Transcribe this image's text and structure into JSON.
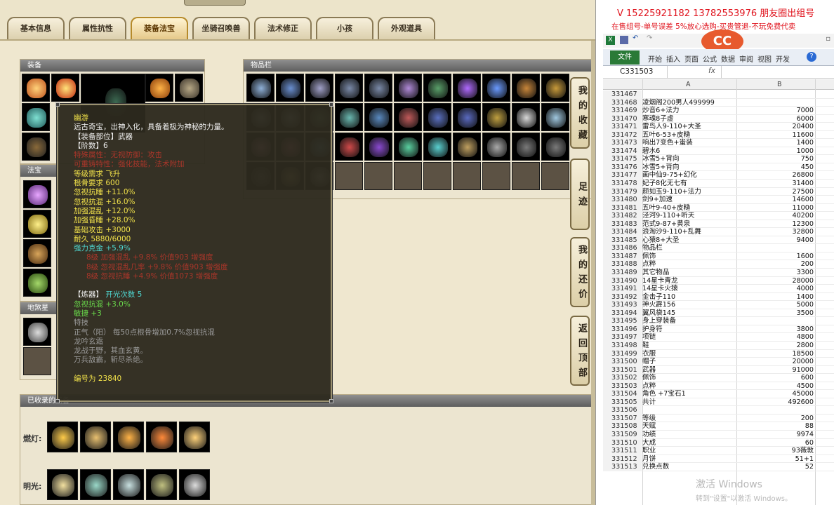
{
  "tabs": [
    {
      "label": "基本信息"
    },
    {
      "label": "属性抗性"
    },
    {
      "label": "装备法宝"
    },
    {
      "label": "坐骑召唤兽"
    },
    {
      "label": "法术修正"
    },
    {
      "label": "小孩"
    },
    {
      "label": "外观道具"
    }
  ],
  "active_tab": "装备法宝",
  "panels": {
    "equipment": "装备",
    "treasure": "法宝",
    "ground_soul": "地煞星",
    "inventory": "物品栏",
    "collected": "已收录的装备"
  },
  "collected": {
    "row1_label": "燃灯:",
    "row2_label": "明光:"
  },
  "side_buttons": [
    "我的收藏",
    "足迹",
    "我的还价",
    "返回顶部"
  ],
  "tooltip": {
    "name": "幽游",
    "desc": "远古奇宝，出神入化，具备着极为神秘的力量。",
    "part": "【装备部位】武器",
    "grade": "【阶数】6",
    "red1": "特殊属性：无视防御：攻击",
    "red2": "可重铸特性：强化技能，法术附加",
    "level_req": "等级需求 飞升",
    "bone_req": "根骨要求 600",
    "stats": [
      "忽视抗睡 +11.0%",
      "忽视抗混 +16.0%",
      "加强混乱 +12.0%",
      "加强昏睡 +28.0%",
      "基础攻击 +3000",
      "耐久 5880/6000"
    ],
    "strong": "强力克金 +5.9%",
    "gems": [
      "8级 加强混乱 +9.8% 价值903 增强度",
      "8级 忽视混乱几率 +9.8% 价值903 增强度",
      "8级 忽视抗睡 +4.9% 价值1073 增强度"
    ],
    "refine_label": "【炼器】",
    "refine_open": "开光次数 5",
    "refine1": "忽视抗混 +3.0%",
    "refine2": "敏捷 +3",
    "special_title": "特技",
    "special1": "正气（阳） 每50点根骨增加0.7%忽视抗混",
    "special2": "龙吟玄霜",
    "special3": "龙战于野，其血玄黄。",
    "special4": "万兵敌霸，斩尽杀绝。",
    "serial": "编号为 23840"
  },
  "excel": {
    "ad_line1": "V 15225921182   13782553976 朋友圈出组号",
    "ad_line2": "在售组号-单号误差 5%放心选购-买贵管退-不玩免费代卖",
    "ribbon": [
      "文件",
      "开始",
      "插入",
      "页面",
      "公式",
      "数据",
      "审阅",
      "视图",
      "开发"
    ],
    "namebox": "C331503",
    "fx": "fx",
    "col_a": "A",
    "col_b": "B",
    "rows": [
      {
        "n": "331467",
        "a": "",
        "b": ""
      },
      {
        "n": "331468",
        "a": "凌烟阁200男人499999",
        "b": ""
      },
      {
        "n": "331469",
        "a": "炒音6+法力",
        "b": "7000"
      },
      {
        "n": "331470",
        "a": "寒魂8子虚",
        "b": "6000"
      },
      {
        "n": "331471",
        "a": "雷鸟人9-110+大圣",
        "b": "20400"
      },
      {
        "n": "331472",
        "a": "五叶6-53+皮糙",
        "b": "11600"
      },
      {
        "n": "331473",
        "a": "响出7变色+蚩装",
        "b": "1400"
      },
      {
        "n": "331474",
        "a": "碧水6",
        "b": "1000"
      },
      {
        "n": "331475",
        "a": "冰雪5+背向",
        "b": "750"
      },
      {
        "n": "331476",
        "a": "冰雪5+背向",
        "b": "450"
      },
      {
        "n": "331477",
        "a": "画中仙9-75+幻化",
        "b": "26800"
      },
      {
        "n": "331478",
        "a": "妃子8化无七有",
        "b": "31400"
      },
      {
        "n": "331479",
        "a": "颜如玉9-110+法力",
        "b": "27500"
      },
      {
        "n": "331480",
        "a": "剑9+加速",
        "b": "14600"
      },
      {
        "n": "331481",
        "a": "五叶9-40+皮糙",
        "b": "11000"
      },
      {
        "n": "331482",
        "a": "泾河9-110+听天",
        "b": "40200"
      },
      {
        "n": "331483",
        "a": "范式9-87+黄泉",
        "b": "12300"
      },
      {
        "n": "331484",
        "a": "浪淘沙9-110+乱舞",
        "b": "32800"
      },
      {
        "n": "331485",
        "a": "心猿8+大圣",
        "b": "9400"
      },
      {
        "n": "331486",
        "a": "物品栏",
        "b": ""
      },
      {
        "n": "331487",
        "a": "佩饰",
        "b": "1600"
      },
      {
        "n": "331488",
        "a": "点粹",
        "b": "200"
      },
      {
        "n": "331489",
        "a": "其它物品",
        "b": "3300"
      },
      {
        "n": "331490",
        "a": "14星卡青龙",
        "b": "28000"
      },
      {
        "n": "331491",
        "a": "14星卡火猿",
        "b": "4000"
      },
      {
        "n": "331492",
        "a": "金击子110",
        "b": "1400"
      },
      {
        "n": "331493",
        "a": "神火霹156",
        "b": "5000"
      },
      {
        "n": "331494",
        "a": "翼风袋145",
        "b": "3500"
      },
      {
        "n": "331495",
        "a": "身上穿装备",
        "b": ""
      },
      {
        "n": "331496",
        "a": "护身符",
        "b": "3800"
      },
      {
        "n": "331497",
        "a": "项链",
        "b": "4800"
      },
      {
        "n": "331498",
        "a": "鞋",
        "b": "2800"
      },
      {
        "n": "331499",
        "a": "衣服",
        "b": "18500"
      },
      {
        "n": "331500",
        "a": "帽子",
        "b": "20000"
      },
      {
        "n": "331501",
        "a": "武器",
        "b": "91000"
      },
      {
        "n": "331502",
        "a": "佩饰",
        "b": "600"
      },
      {
        "n": "331503",
        "a": "点粹",
        "b": "4500"
      },
      {
        "n": "331504",
        "a": "角色 +7宝石1",
        "b": "45000"
      },
      {
        "n": "331505",
        "a": "共计",
        "b": "492600"
      },
      {
        "n": "331506",
        "a": "",
        "b": ""
      },
      {
        "n": "331507",
        "a": "等级",
        "b": "200"
      },
      {
        "n": "331508",
        "a": "天赋",
        "b": "88"
      },
      {
        "n": "331509",
        "a": "功绩",
        "b": "9974"
      },
      {
        "n": "331510",
        "a": "大成",
        "b": "60"
      },
      {
        "n": "331511",
        "a": "职业",
        "b": "93薇敦"
      },
      {
        "n": "331512",
        "a": "月饼",
        "b": "51+1"
      },
      {
        "n": "331513",
        "a": "兑换点数",
        "b": "52"
      }
    ],
    "watermark1": "激活 Windows",
    "watermark2": "转到\"设置\"以激活 Windows。",
    "logo_text": "CC"
  },
  "colors": {
    "accent": "#b68a2a",
    "tooltip_bg": "#2d2a1e",
    "excel_green": "#2a7a37"
  }
}
